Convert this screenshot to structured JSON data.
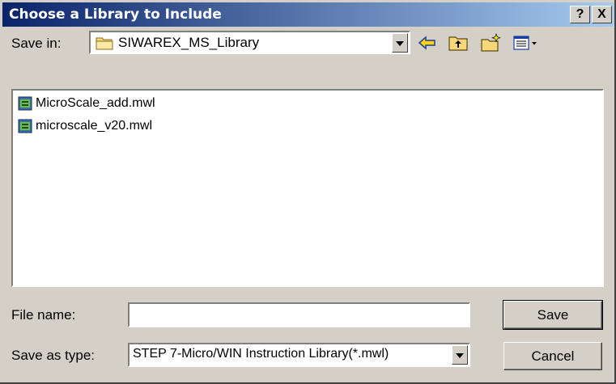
{
  "dialog": {
    "title": "Choose a Library to Include",
    "help_label": "?",
    "close_label": "X"
  },
  "toolbar": {
    "save_in_label": "Save in:",
    "save_in_value": "SIWAREX_MS_Library",
    "icons": [
      "back-icon",
      "up-folder-icon",
      "new-folder-icon",
      "view-menu-icon"
    ]
  },
  "files": [
    {
      "name": "MicroScale_add.mwl"
    },
    {
      "name": "microscale_v20.mwl"
    }
  ],
  "form": {
    "file_name_label": "File name:",
    "file_name_value": "",
    "save_as_type_label": "Save as type:",
    "save_as_type_value": "STEP 7-Micro/WIN Instruction Library(*.mwl)"
  },
  "buttons": {
    "save_label": "Save",
    "cancel_label": "Cancel"
  },
  "colors": {
    "title_gradient_start": "#0a246a",
    "title_gradient_end": "#a6caf0",
    "dialog_face": "#d4d0c8"
  }
}
